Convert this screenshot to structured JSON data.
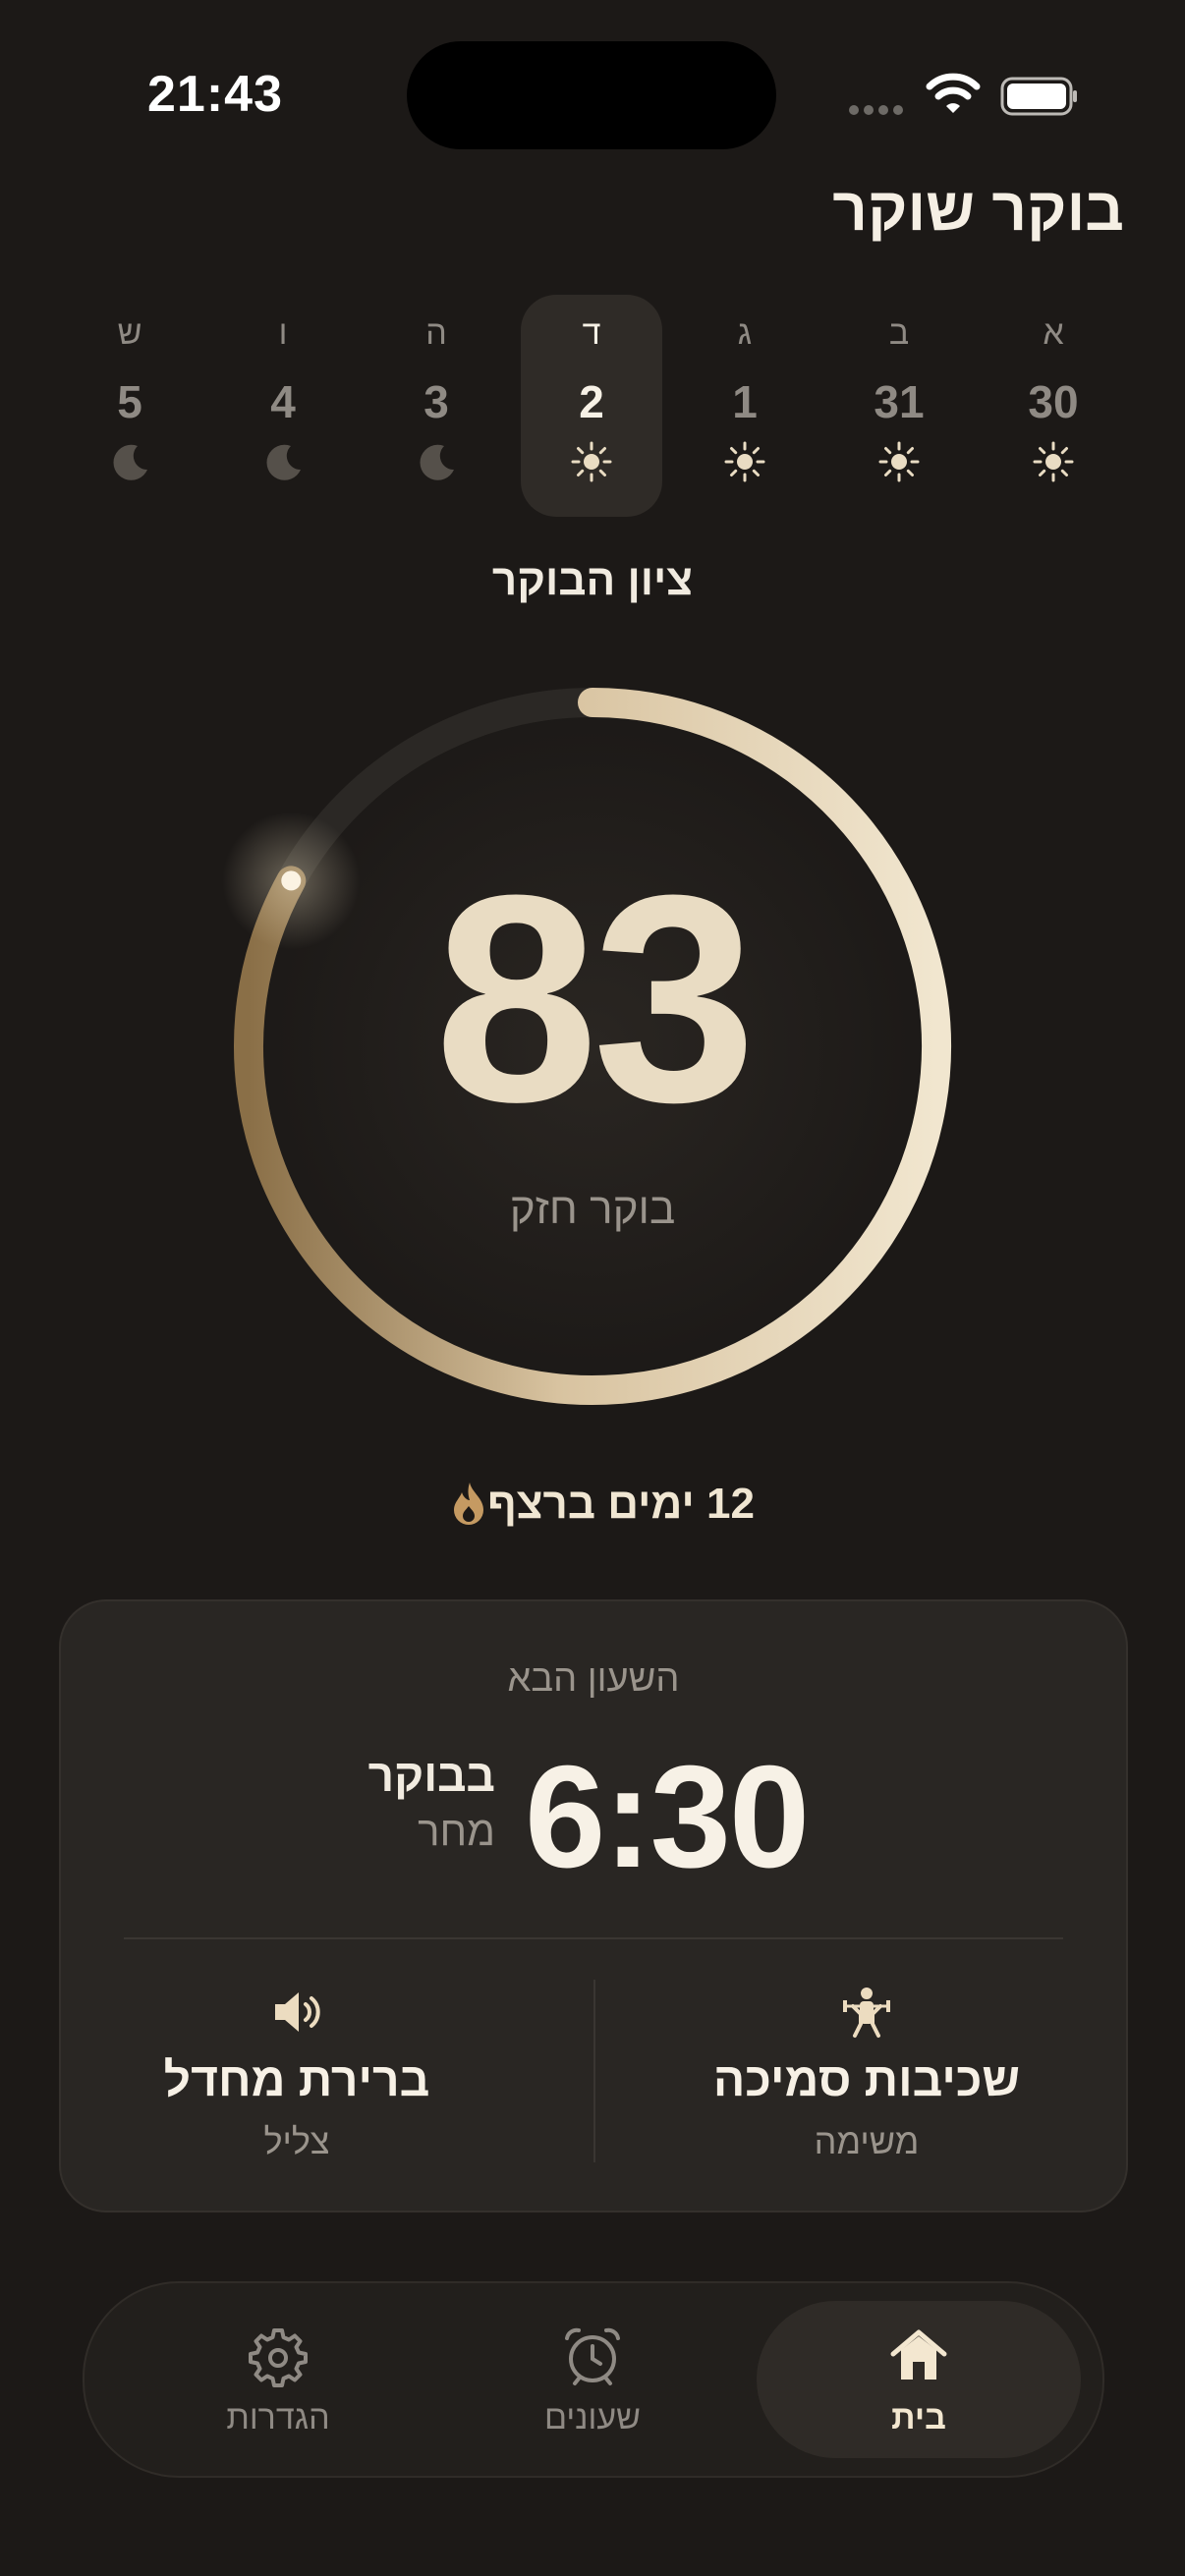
{
  "status_bar": {
    "time": "21:43"
  },
  "header": {
    "title": "בוקר שוקר"
  },
  "days": [
    {
      "letter": "ש",
      "number": "5",
      "icon": "moon-icon",
      "active": false
    },
    {
      "letter": "ו",
      "number": "4",
      "icon": "moon-icon",
      "active": false
    },
    {
      "letter": "ה",
      "number": "3",
      "icon": "moon-icon",
      "active": false
    },
    {
      "letter": "ד",
      "number": "2",
      "icon": "sun-icon",
      "active": true
    },
    {
      "letter": "ג",
      "number": "1",
      "icon": "sun-icon",
      "active": false
    },
    {
      "letter": "ב",
      "number": "31",
      "icon": "sun-icon",
      "active": false
    },
    {
      "letter": "א",
      "number": "30",
      "icon": "sun-icon",
      "active": false
    }
  ],
  "score": {
    "label": "ציון הבוקר",
    "value": "83",
    "progress": 0.83,
    "caption": "בוקר חזק"
  },
  "streak": {
    "text": "12 ימים ברצף",
    "icon": "flame-icon"
  },
  "next_alarm": {
    "label": "השעון הבא",
    "time": "6:30",
    "period": "בבוקר",
    "day": "מחר",
    "task": {
      "name": "שכיבות סמיכה",
      "caption": "משימה",
      "icon": "weightlifter-icon"
    },
    "sound": {
      "name": "ברירת מחדל",
      "caption": "צליל",
      "icon": "speaker-icon"
    }
  },
  "tabs": [
    {
      "label": "הגדרות",
      "icon": "gear-icon",
      "active": false
    },
    {
      "label": "שעונים",
      "icon": "alarm-clock-icon",
      "active": false
    },
    {
      "label": "בית",
      "icon": "home-icon",
      "active": true
    }
  ],
  "colors": {
    "background": "#1c1917",
    "accent": "#e9dcc3",
    "accent_dark": "#8a6f47",
    "muted": "#8f8a84"
  }
}
